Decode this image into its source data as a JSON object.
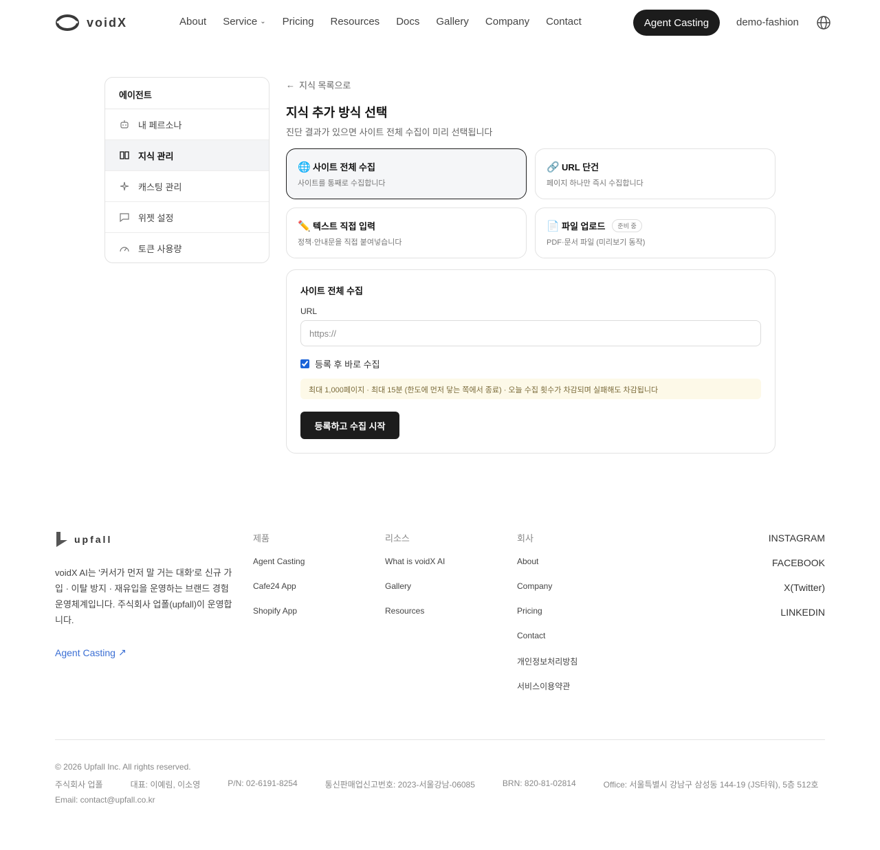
{
  "header": {
    "logo_text": "voidX",
    "nav": [
      "About",
      "Service",
      "Pricing",
      "Resources",
      "Docs",
      "Gallery",
      "Company",
      "Contact"
    ],
    "cta_label": "Agent Casting",
    "workspace": "demo-fashion"
  },
  "sidebar": {
    "heading": "에이전트",
    "items": [
      {
        "label": "내 페르소나",
        "icon": "robot-icon"
      },
      {
        "label": "지식 관리",
        "icon": "book-icon"
      },
      {
        "label": "캐스팅 관리",
        "icon": "sparkle-icon"
      },
      {
        "label": "위젯 설정",
        "icon": "chat-icon"
      },
      {
        "label": "토큰 사용량",
        "icon": "gauge-icon"
      }
    ]
  },
  "main": {
    "back_label": "지식 목록으로",
    "title": "지식 추가 방식 선택",
    "subtitle": "진단 결과가 있으면 사이트 전체 수집이 미리 선택됩니다",
    "options": [
      {
        "emoji": "🌐",
        "title": "사이트 전체 수집",
        "desc": "사이트를 통째로 수집합니다"
      },
      {
        "emoji": "🔗",
        "title": "URL 단건",
        "desc": "페이지 하나만 즉시 수집합니다"
      },
      {
        "emoji": "✏️",
        "title": "텍스트 직접 입력",
        "desc": "정책·안내문을 직접 붙여넣습니다"
      },
      {
        "emoji": "📄",
        "title": "파일 업로드",
        "badge": "준비 중",
        "desc": "PDF·문서 파일 (미리보기 동작)"
      }
    ],
    "panel": {
      "title": "사이트 전체 수집",
      "url_label": "URL",
      "url_placeholder": "https://",
      "checkbox_label": "등록 후 바로 수집",
      "notice": "최대 1,000페이지 · 최대 15분 (한도에 먼저 닿는 쪽에서 종료) · 오늘 수집 횟수가 차감되며 실패해도 차감됩니다",
      "submit_label": "등록하고 수집 시작"
    }
  },
  "footer": {
    "logo_text": "upfall",
    "description": "voidX AI는 '커서가 먼저 말 거는 대화'로 신규 가입 · 이탈 방지 · 재유입을 운영하는 브랜드 경험 운영체계입니다. 주식회사 업폴(upfall)이 운영합니다.",
    "agent_link": "Agent Casting",
    "columns": [
      {
        "title": "제품",
        "links": [
          "Agent Casting",
          "Cafe24 App",
          "Shopify App"
        ]
      },
      {
        "title": "리소스",
        "links": [
          "What is voidX AI",
          "Gallery",
          "Resources"
        ]
      },
      {
        "title": "회사",
        "links": [
          "About",
          "Company",
          "Pricing",
          "Contact",
          "개인정보처리방침",
          "서비스이용약관"
        ]
      }
    ],
    "social": [
      "INSTAGRAM",
      "FACEBOOK",
      "X(Twitter)",
      "LINKEDIN"
    ],
    "copyright": "© 2026 Upfall Inc. All rights reserved.",
    "biz": [
      "주식회사 업폴",
      "대표: 이예림, 이소영",
      "P/N: 02-6191-8254",
      "통신판매업신고번호: 2023-서울강남-06085",
      "BRN: 820-81-02814",
      "Office: 서울특별시 강남구 삼성동 144-19 (JS타워), 5층 512호"
    ],
    "email": "Email: contact@upfall.co.kr"
  }
}
